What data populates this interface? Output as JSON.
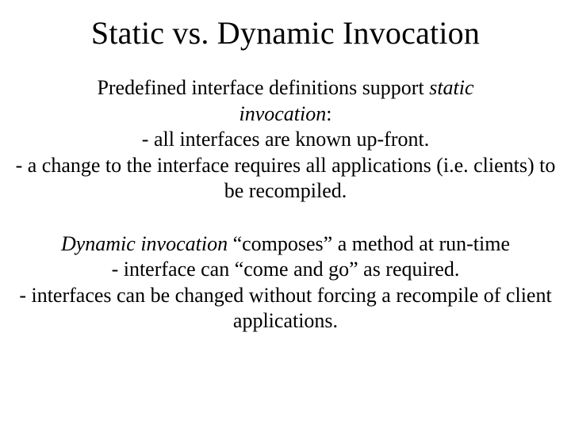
{
  "title": "Static vs. Dynamic Invocation",
  "para1": {
    "lead_a": "Predefined interface definitions support ",
    "lead_b_italic": "static",
    "lead_c_italic_line2": "invocation",
    "lead_d": ":",
    "bullet1": "-  all interfaces are known up-front.",
    "bullet2": "-  a change to the interface requires all applications (i.e. clients) to be recompiled."
  },
  "para2": {
    "lead_a_italic": "Dynamic invocation",
    "lead_b": " “composes” a method at run-time",
    "bullet1": "-  interface can “come and go” as required.",
    "bullet2": "-  interfaces can be changed without forcing a recompile of client applications."
  }
}
